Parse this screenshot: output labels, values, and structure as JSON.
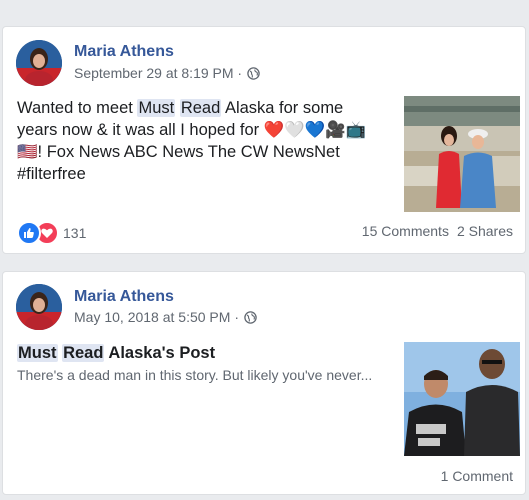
{
  "posts": [
    {
      "author": "Maria Athens",
      "timestamp": "September 29 at 8:19 PM",
      "privacy_icon": "globe-icon",
      "text": {
        "before": "Wanted to meet ",
        "hl1": "Must",
        "hl2": "Read",
        "after1": " Alaska for some years now & it was all I hoped for ",
        "emojis": "❤️🤍💙🎥📺🇺🇸",
        "after2": "! Fox News ABC News The CW NewsNet #filterfree"
      },
      "reactions": {
        "count": "131",
        "icons": [
          "like-icon",
          "love-icon"
        ]
      },
      "comments": "15 Comments",
      "shares": "2 Shares"
    },
    {
      "author": "Maria Athens",
      "timestamp": "May 10, 2018 at 5:50 PM",
      "privacy_icon": "globe-icon",
      "shared": {
        "title_hl1": "Must",
        "title_hl2": "Read",
        "title_rest": " Alaska's Post",
        "description": "There's a dead man in this story. But likely you've never..."
      },
      "comments": "1 Comment"
    }
  ],
  "colors": {
    "link": "#365899",
    "meta": "#606770",
    "like": "#2078f4",
    "love": "#f33e58",
    "highlight": "#dfe5f2"
  }
}
